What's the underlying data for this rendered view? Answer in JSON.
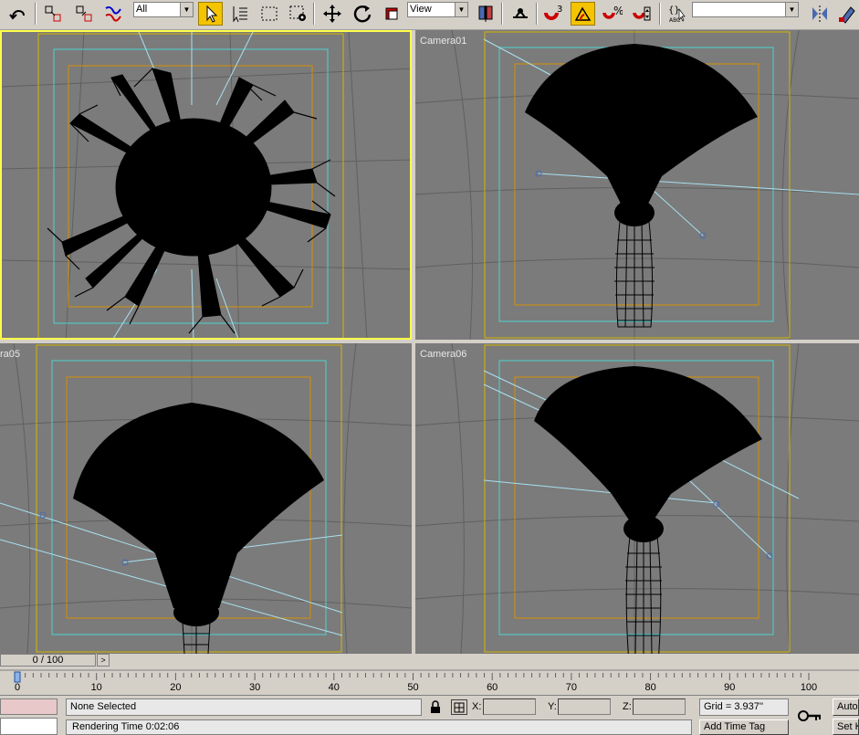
{
  "toolbar": {
    "selection_filter": "All",
    "reference_coordinate": "View",
    "named_selection": ""
  },
  "viewports": [
    {
      "label": "",
      "active": true
    },
    {
      "label": "Camera01",
      "active": false
    },
    {
      "label": "ra05",
      "active": false
    },
    {
      "label": "Camera06",
      "active": false
    }
  ],
  "timeline": {
    "frame_counter": "0 / 100",
    "next_arrow": ">",
    "ticks": [
      "0",
      "10",
      "20",
      "30",
      "40",
      "50",
      "60",
      "70",
      "80",
      "90",
      "100"
    ]
  },
  "status": {
    "selection": "None Selected",
    "x_label": "X:",
    "y_label": "Y:",
    "z_label": "Z:",
    "grid": "Grid = 3.937''",
    "rendering_time": "Rendering Time  0:02:06",
    "add_time_tag": "Add Time Tag",
    "auto_key": "Auto",
    "set_key": "Set K"
  },
  "colors": {
    "viewport_bg": "#7b7b7b",
    "safe_frame_outer": "#d4b400",
    "safe_frame_action": "#4fd2d2",
    "safe_frame_title": "#d49000",
    "active_border": "#ffff4a",
    "ui_gray": "#d4d0c8"
  }
}
